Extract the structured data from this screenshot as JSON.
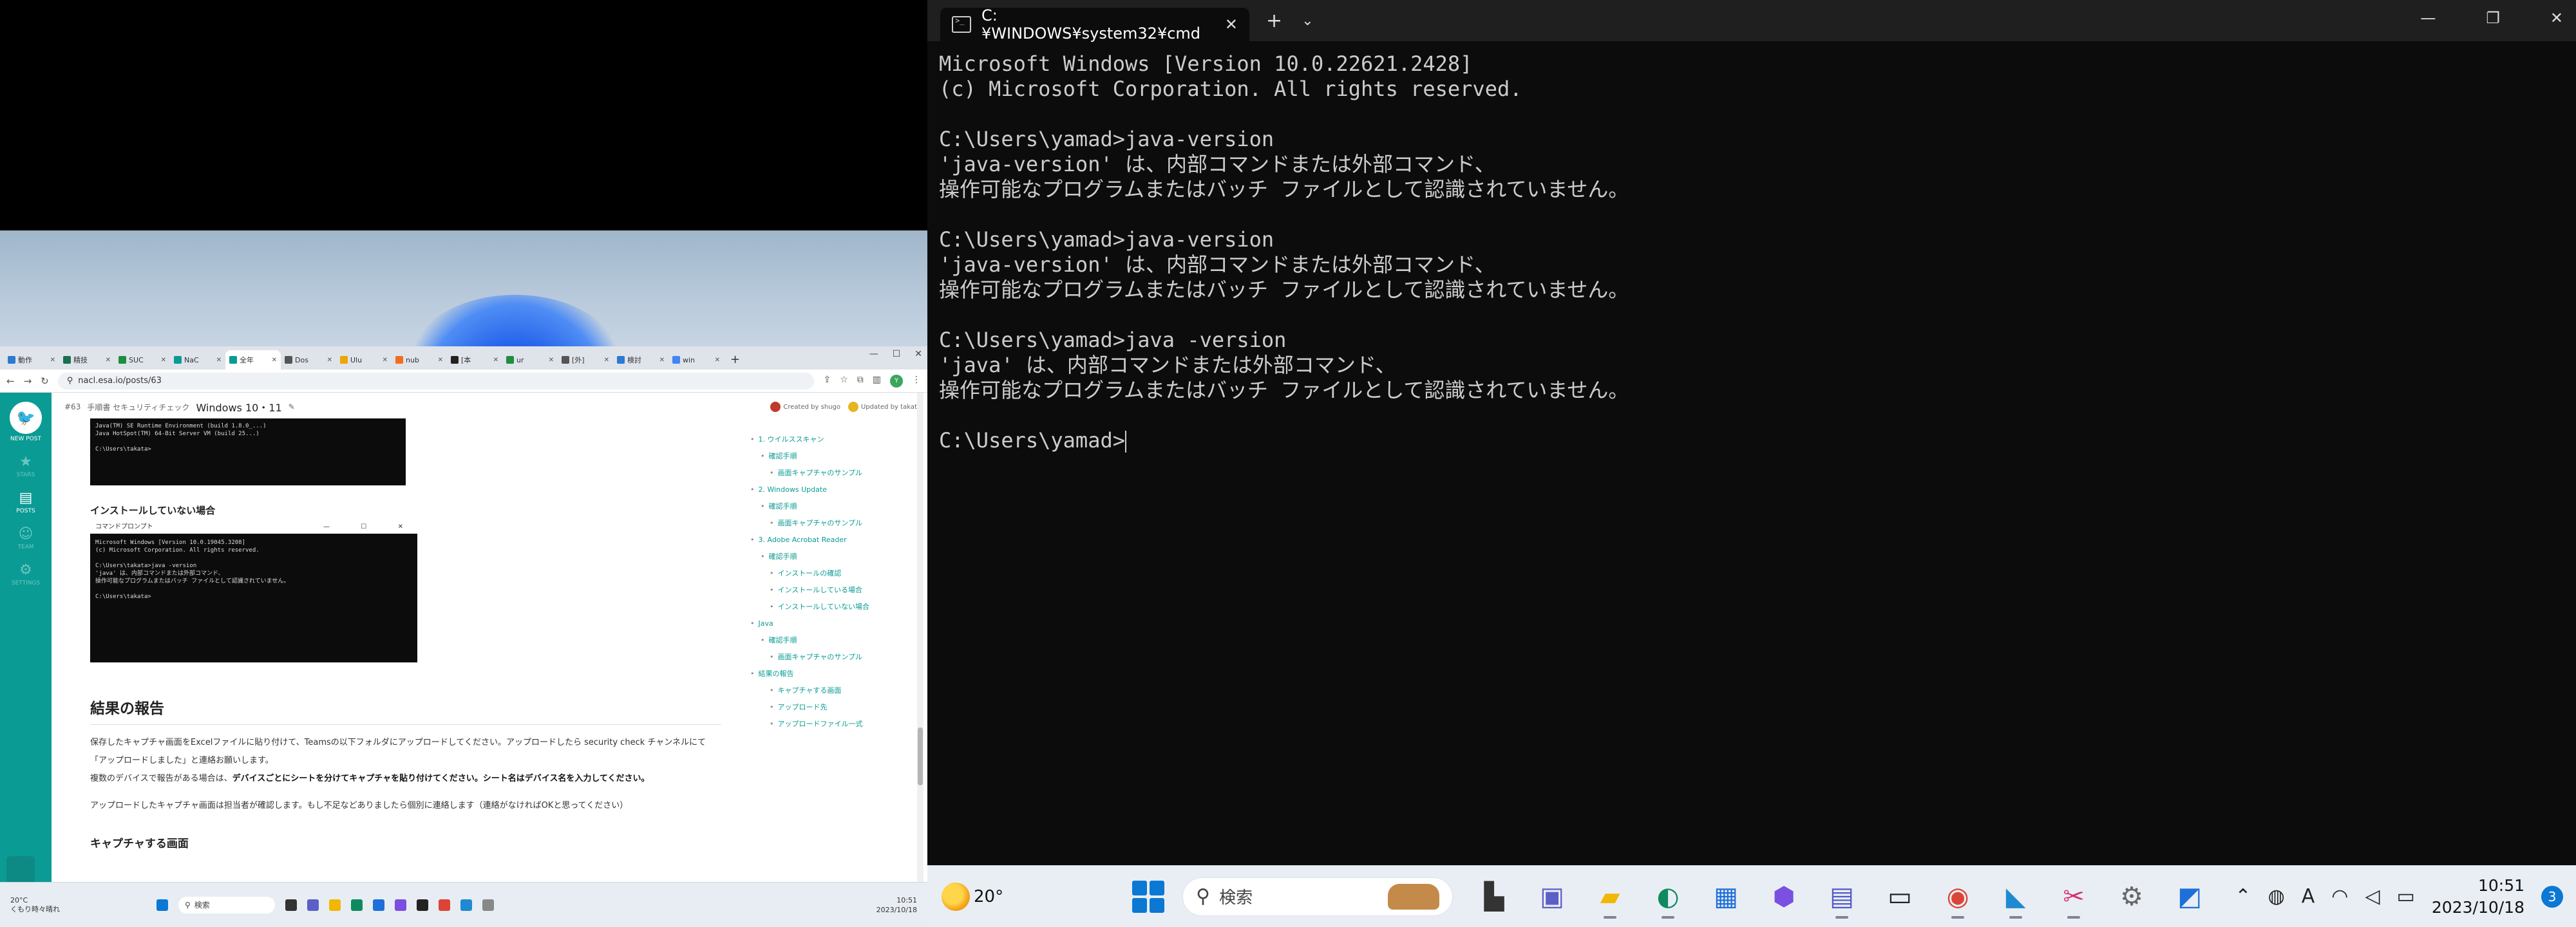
{
  "browser": {
    "tabs": [
      {
        "label": "動作",
        "color": "#2b7bd1"
      },
      {
        "label": "精技",
        "color": "#1b6f52"
      },
      {
        "label": "SUC",
        "color": "#1e8e3e"
      },
      {
        "label": "NaC",
        "color": "#0a9b94"
      },
      {
        "label": "全年",
        "color": "#0a9b94"
      },
      {
        "label": "Dos",
        "color": "#555555"
      },
      {
        "label": "Ulu",
        "color": "#f0a500"
      },
      {
        "label": "nub",
        "color": "#f36d21"
      },
      {
        "label": "[本",
        "color": "#222222"
      },
      {
        "label": "ur",
        "color": "#1e8e3e"
      },
      {
        "label": "[外]",
        "color": "#555555"
      },
      {
        "label": "検討",
        "color": "#2b7bd1"
      },
      {
        "label": "win",
        "color": "#4285f4"
      }
    ],
    "url": "nacl.esa.io/posts/63",
    "post": {
      "number": "#63",
      "path": "手順書 セキュリティチェック",
      "title": "Windows 10・11",
      "created_by": "Created by shugo",
      "updated_by": "Updated by takata"
    },
    "nav": {
      "new_post": "NEW POST",
      "posts": "POSTS",
      "items": [
        "STARS",
        "TEAM",
        "SETTINGS"
      ]
    },
    "screenshot1_text": "Java(TM) SE Runtime Environment (build 1.8.0_...)\nJava HotSpot(TM) 64-Bit Server VM (build 25...)\n\nC:\\Users\\takata>",
    "subheading_not_installed": "インストールしていない場合",
    "screenshot2": {
      "title": "コマンドプロンプト",
      "controls": "—  ☐  ✕",
      "text": "Microsoft Windows [Version 10.0.19045.3208]\n(c) Microsoft Corporation. All rights reserved.\n\nC:\\Users\\takata>java -version\n'java' は、内部コマンドまたは外部コマンド、\n操作可能なプログラムまたはバッチ ファイルとして認識されていません。\n\nC:\\Users\\takata>"
    },
    "report_heading": "結果の報告",
    "report_p1": "保存したキャプチャ画面をExcelファイルに貼り付けて、Teamsの以下フォルダにアップロードしてください。アップロードしたら security check チャンネルにて「アップロードしました」と連絡お願いします。",
    "report_p2_pre": "複数のデバイスで報告がある場合は、",
    "report_p2_bold": "デバイスごとにシートを分けてキャプチャを貼り付けてください。シート名はデバイス名を入力してください。",
    "report_p3": "アップロードしたキャプチャ画面は担当者が確認します。もし不足などありましたら個別に連絡します（連絡がなければOKと思ってください）",
    "capture_heading": "キャプチャする画面",
    "toc": [
      {
        "level": 1,
        "text": "1. ウイルススキャン"
      },
      {
        "level": 2,
        "text": "確認手順"
      },
      {
        "level": 3,
        "text": "画面キャプチャのサンプル"
      },
      {
        "level": 1,
        "text": "2. Windows Update"
      },
      {
        "level": 2,
        "text": "確認手順"
      },
      {
        "level": 3,
        "text": "画面キャプチャのサンプル"
      },
      {
        "level": 1,
        "text": "3. Adobe Acrobat Reader"
      },
      {
        "level": 2,
        "text": "確認手順"
      },
      {
        "level": 3,
        "text": "インストールの確認"
      },
      {
        "level": 3,
        "text": "インストールしている場合"
      },
      {
        "level": 3,
        "text": "インストールしていない場合"
      },
      {
        "level": 1,
        "text": "Java"
      },
      {
        "level": 2,
        "text": "確認手順"
      },
      {
        "level": 3,
        "text": "画面キャプチャのサンプル"
      },
      {
        "level": 1,
        "text": "結果の報告"
      },
      {
        "level": 3,
        "text": "キャプチャする画面"
      },
      {
        "level": 3,
        "text": "アップロード先"
      },
      {
        "level": 3,
        "text": "アップロードファイル一式"
      }
    ],
    "taskbar": {
      "temp": "20°C",
      "weather": "くもり時々晴れ",
      "search": "検索",
      "time": "10:51",
      "date": "2023/10/18"
    }
  },
  "terminal": {
    "tab_title": "C:¥WINDOWS¥system32¥cmd",
    "lines": [
      "Microsoft Windows [Version 10.0.22621.2428]",
      "(c) Microsoft Corporation. All rights reserved.",
      "",
      "C:\\Users\\yamad>java-version",
      "'java-version' は、内部コマンドまたは外部コマンド、",
      "操作可能なプログラムまたはバッチ ファイルとして認識されていません。",
      "",
      "C:\\Users\\yamad>java-version",
      "'java-version' は、内部コマンドまたは外部コマンド、",
      "操作可能なプログラムまたはバッチ ファイルとして認識されていません。",
      "",
      "C:\\Users\\yamad>java -version",
      "'java' は、内部コマンドまたは外部コマンド、",
      "操作可能なプログラムまたはバッチ ファイルとして認識されていません。",
      ""
    ],
    "prompt": "C:\\Users\\yamad>"
  },
  "taskbar": {
    "temp": "20°",
    "search_placeholder": "検索",
    "time": "10:51",
    "date": "2023/10/18",
    "notifications": "3",
    "apps": [
      "file-explorer-dark-icon",
      "teams-meet-icon",
      "folder-icon",
      "edge-icon",
      "store-icon",
      "copilot-icon",
      "teams-icon",
      "terminal-icon",
      "chrome-icon",
      "vscode-icon",
      "snipping-icon",
      "settings-icon",
      "remote-icon"
    ]
  },
  "colors": {
    "accent": "#0a9b94",
    "windows_blue": "#0b78d4",
    "terminal_bg": "#0c0c0c"
  }
}
